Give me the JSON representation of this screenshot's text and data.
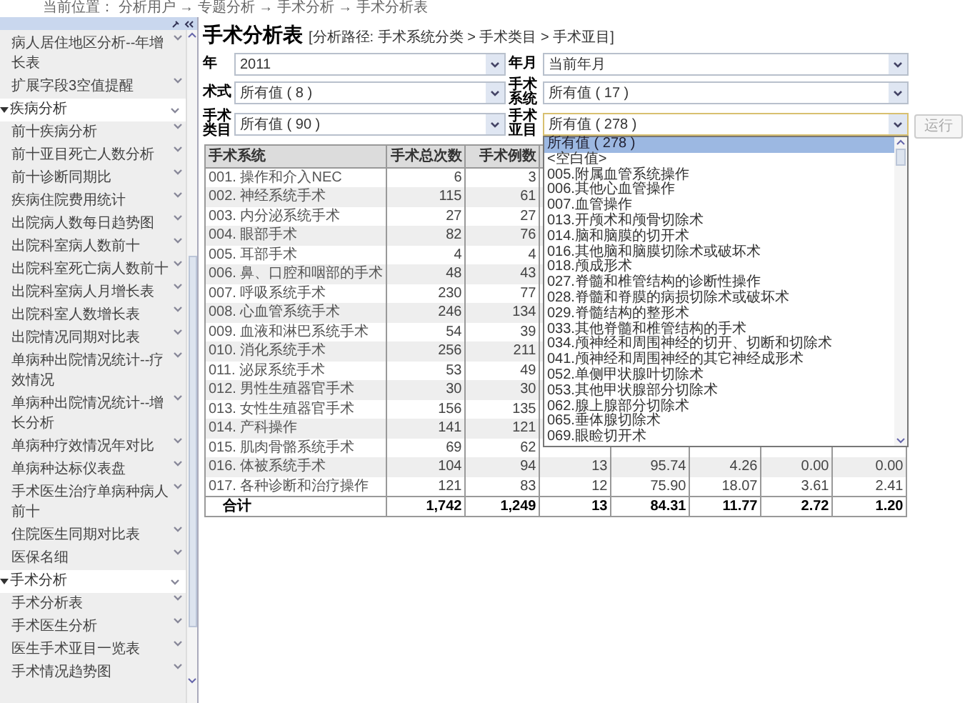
{
  "breadcrumb": "当前位置： 分析用户 → 专题分析 → 手术分析 → 手术分析表",
  "sidebar": {
    "items": [
      {
        "kind": "item",
        "label": "病人居住地区分析--年增长表"
      },
      {
        "kind": "item",
        "label": "扩展字段3空值提醒"
      },
      {
        "kind": "group",
        "label": "疾病分析",
        "expanded": true,
        "children": [
          {
            "kind": "item",
            "label": "前十疾病分析"
          },
          {
            "kind": "item",
            "label": "前十亚目死亡人数分析"
          },
          {
            "kind": "item",
            "label": "前十诊断同期比"
          },
          {
            "kind": "item",
            "label": "疾病住院费用统计"
          },
          {
            "kind": "item",
            "label": "出院病人数每日趋势图"
          },
          {
            "kind": "item",
            "label": "出院科室病人数前十"
          },
          {
            "kind": "item",
            "label": "出院科室死亡病人数前十"
          },
          {
            "kind": "item",
            "label": "出院科室病人月增长表"
          },
          {
            "kind": "item",
            "label": "出院科室人数增长表"
          },
          {
            "kind": "item",
            "label": "出院情况同期对比表"
          },
          {
            "kind": "item",
            "label": "单病种出院情况统计--疗效情况"
          },
          {
            "kind": "item",
            "label": "单病种出院情况统计--增长分析"
          },
          {
            "kind": "item",
            "label": "单病种疗效情况年对比"
          },
          {
            "kind": "item",
            "label": "单病种达标仪表盘"
          },
          {
            "kind": "item",
            "label": "手术医生治疗单病种病人前十"
          },
          {
            "kind": "item",
            "label": "住院医生同期对比表"
          },
          {
            "kind": "item",
            "label": "医保名细"
          }
        ]
      },
      {
        "kind": "group",
        "label": "手术分析",
        "expanded": true,
        "children": [
          {
            "kind": "item",
            "label": "手术分析表"
          },
          {
            "kind": "item",
            "label": "手术医生分析"
          },
          {
            "kind": "item",
            "label": "医生手术亚目一览表"
          },
          {
            "kind": "item",
            "label": "手术情况趋势图"
          }
        ]
      }
    ]
  },
  "title": "手术分析表",
  "analysis_path": "[分析路径: 手术系统分类 > 手术类目 > 手术亚目]",
  "filters": [
    {
      "label": "年",
      "value": "2011",
      "expanded": false
    },
    {
      "label": "年月",
      "value": "当前年月",
      "expanded": false
    },
    {
      "label": "术式",
      "value": "所有值 ( 8 )",
      "expanded": false
    },
    {
      "label": "手术系统",
      "value": "所有值 ( 17 )",
      "expanded": false
    },
    {
      "label": "手术类目",
      "value": "所有值 ( 90 )",
      "expanded": false
    },
    {
      "label": "手术亚目",
      "value": "所有值 ( 278 )",
      "expanded": true
    }
  ],
  "run_button": {
    "label": "运行",
    "disabled": true
  },
  "dropdown_options": [
    {
      "label": "所有值 ( 278 )",
      "selected": true
    },
    {
      "label": "<空白值>",
      "selected": false
    },
    {
      "label": "005.附属血管系统操作",
      "selected": false
    },
    {
      "label": "006.其他心血管操作",
      "selected": false
    },
    {
      "label": "007.血管操作",
      "selected": false
    },
    {
      "label": "013.开颅术和颅骨切除术",
      "selected": false
    },
    {
      "label": "014.脑和脑膜的切开术",
      "selected": false
    },
    {
      "label": "016.其他脑和脑膜切除术或破坏术",
      "selected": false
    },
    {
      "label": "018.颅成形术",
      "selected": false
    },
    {
      "label": "027.脊髓和椎管结构的诊断性操作",
      "selected": false
    },
    {
      "label": "028.脊髓和脊膜的病损切除术或破坏术",
      "selected": false
    },
    {
      "label": "029.脊髓结构的整形术",
      "selected": false
    },
    {
      "label": "033.其他脊髓和椎管结构的手术",
      "selected": false
    },
    {
      "label": "034.颅神经和周围神经的切开、切断和切除术",
      "selected": false
    },
    {
      "label": "041.颅神经和周围神经的其它神经成形术",
      "selected": false
    },
    {
      "label": "052.单侧甲状腺叶切除术",
      "selected": false
    },
    {
      "label": "053.其他甲状腺部分切除术",
      "selected": false
    },
    {
      "label": "062.腺上腺部分切除术",
      "selected": false
    },
    {
      "label": "065.垂体腺切除术",
      "selected": false
    },
    {
      "label": "069.眼睑切开术",
      "selected": false
    }
  ],
  "table": {
    "columns": [
      "手术系统",
      "手术总次数",
      "手术例数"
    ],
    "rows": [
      [
        "001. 操作和介入NEC",
        "6",
        "3"
      ],
      [
        "002. 神经系统手术",
        "115",
        "61"
      ],
      [
        "003. 内分泌系统手术",
        "27",
        "27"
      ],
      [
        "004. 眼部手术",
        "82",
        "76"
      ],
      [
        "005. 耳部手术",
        "4",
        "4"
      ],
      [
        "006. 鼻、口腔和咽部的手术",
        "48",
        "43"
      ],
      [
        "007. 呼吸系统手术",
        "230",
        "77"
      ],
      [
        "008. 心血管系统手术",
        "246",
        "134"
      ],
      [
        "009. 血液和淋巴系统手术",
        "54",
        "39"
      ],
      [
        "010. 消化系统手术",
        "256",
        "211"
      ],
      [
        "011. 泌尿系统手术",
        "53",
        "49"
      ],
      [
        "012. 男性生殖器官手术",
        "30",
        "30"
      ],
      [
        "013. 女性生殖器官手术",
        "156",
        "135"
      ],
      [
        "014. 产科操作",
        "141",
        "121"
      ],
      [
        "015. 肌肉骨骼系统手术",
        "69",
        "62"
      ],
      [
        "016. 体被系统手术",
        "104",
        "94",
        "13",
        "95.74",
        "4.26",
        "0.00",
        "0.00"
      ],
      [
        "017. 各种诊断和治疗操作",
        "121",
        "83",
        "12",
        "75.90",
        "18.07",
        "3.61",
        "2.41"
      ]
    ],
    "total": [
      "合计",
      "1,742",
      "1,249",
      "13",
      "84.31",
      "11.77",
      "2.72",
      "1.20"
    ]
  }
}
